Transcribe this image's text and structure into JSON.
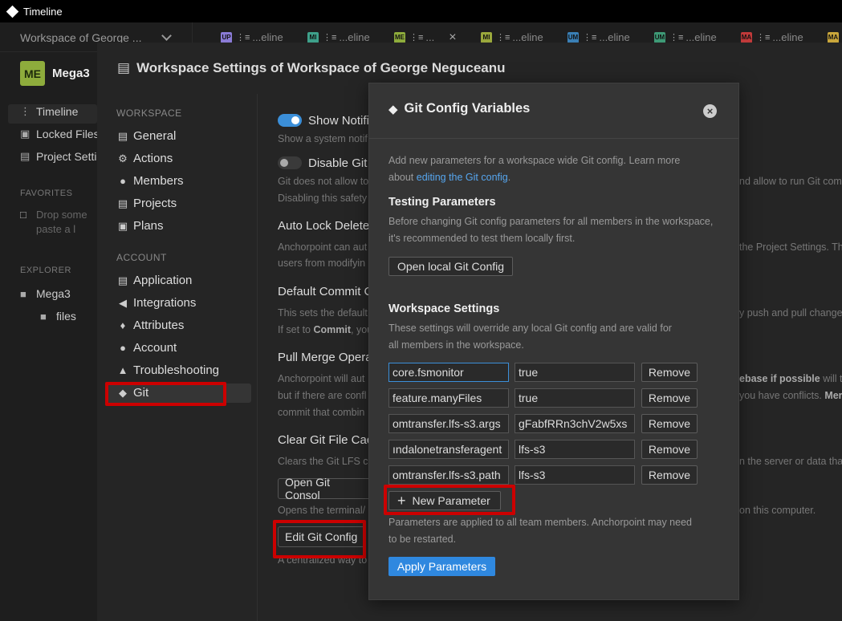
{
  "window": {
    "title": "Timeline"
  },
  "tabbar": {
    "workspace": "Workspace of George ...",
    "tabs": [
      {
        "badge": "UP",
        "color": "#8a7bd6",
        "label": "...eline"
      },
      {
        "badge": "MI",
        "color": "#3ea08a",
        "label": "...eline"
      },
      {
        "badge": "ME",
        "color": "#8eac3c",
        "label": "...",
        "active": true
      },
      {
        "badge": "MI",
        "color": "#9aa83c",
        "label": "...eline"
      },
      {
        "badge": "UM",
        "color": "#3a7fb5",
        "label": "...eline"
      },
      {
        "badge": "UM",
        "color": "#3e9a76",
        "label": "...eline"
      },
      {
        "badge": "MA",
        "color": "#c03a3a",
        "label": "...eline"
      },
      {
        "badge": "MA",
        "color": "#c9a63b",
        "label": ""
      }
    ]
  },
  "sidebar": {
    "avatar": "ME",
    "project": "Mega3",
    "items": [
      "Timeline",
      "Locked Files",
      "Project Settings"
    ],
    "favorites": "FAVORITES",
    "drop": [
      "Drop some",
      "paste a l"
    ],
    "explorer": "EXPLORER",
    "tree": [
      "Mega3",
      "files"
    ]
  },
  "settings": {
    "title": "Workspace Settings of Workspace of George Neguceanu",
    "nav": {
      "workspace_label": "WORKSPACE",
      "workspace": [
        "General",
        "Actions",
        "Members",
        "Projects",
        "Plans"
      ],
      "account_label": "ACCOUNT",
      "account": [
        "Application",
        "Integrations",
        "Attributes",
        "Account",
        "Troubleshooting",
        "Git"
      ]
    },
    "content": {
      "show_notif": "Show Notifi",
      "show_notif_desc": "Show a system notif",
      "disable_git": "Disable Git",
      "disable_desc1": "Git does not allow to",
      "disable_desc2": "Disabling this safety",
      "auto_lock": "Auto Lock Deleted",
      "auto_lock_desc1": "Anchorpoint can aut",
      "auto_lock_desc2": "users from modifyin",
      "default_commit": "Default Commit C",
      "default_commit_desc1": "This sets the default",
      "default_commit_desc2a": "If set to ",
      "default_commit_desc2b": "Commit",
      "default_commit_desc2c": ", you",
      "pull_merge": "Pull Merge Opera",
      "pull_desc1": "Anchorpoint will aut",
      "pull_desc2": "but if there are confl",
      "pull_desc3": "commit that combin",
      "clear_cache": "Clear Git File Cac",
      "clear_desc": "Clears the Git LFS c",
      "open_console": "Open Git Consol",
      "open_console_desc": "Opens the terminal/",
      "edit_config": "Edit Git Config",
      "edit_config_desc": "A centralized way to"
    },
    "right_overflow": {
      "r1": "nd allow to run Git comm",
      "r2": "the Project Settings. Th",
      "r3": "y push and pull changes",
      "r4a": "ebase if possible",
      "r4b": " will t",
      "r5a": "you have conflicts. ",
      "r5b": "Mer",
      "r6": "n the server or data tha",
      "r7": "on this computer."
    }
  },
  "modal": {
    "title": "Git Config Variables",
    "intro": "Add new parameters for a workspace wide Git config. Learn more",
    "intro2": "about ",
    "link": "editing the Git config",
    "intro_end": ".",
    "testing_title": "Testing Parameters",
    "testing_desc1": "Before changing Git config parameters for all members in the workspace,",
    "testing_desc2": "it's recommended to test them locally first.",
    "open_local": "Open local Git Config",
    "ws_title": "Workspace Settings",
    "ws_desc1": "These settings will override any local Git config and are valid for",
    "ws_desc2": "all members in the workspace.",
    "params": [
      {
        "key": "core.fsmonitor",
        "value": "true"
      },
      {
        "key": "feature.manyFiles",
        "value": "true"
      },
      {
        "key": "omtransfer.lfs-s3.args",
        "value": "gFabfRRn3chV2w5xs"
      },
      {
        "key": "ındalonetransferagent",
        "value": "lfs-s3"
      },
      {
        "key": "omtransfer.lfs-s3.path",
        "value": "lfs-s3"
      }
    ],
    "remove_label": "Remove",
    "new_param": "New Parameter",
    "footer1": "Parameters are applied to all team members. Anchorpoint may need",
    "footer2": "to be restarted.",
    "apply": "Apply Parameters"
  },
  "colors": {
    "accent": "#2f88df",
    "highlight": "#cc0000"
  }
}
